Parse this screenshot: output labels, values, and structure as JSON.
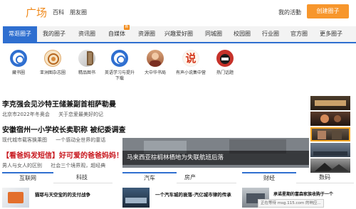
{
  "header": {
    "logo": "广场",
    "links": [
      "百科",
      "朋友圈"
    ],
    "activity": "我的活動",
    "create_button": "创建圈子"
  },
  "nav": {
    "tabs": [
      "常逛圈子",
      "我的圈子",
      "资讯圈",
      "自媒体",
      "资源圈",
      "兴趣爱好圈",
      "同城圈",
      "校园圈",
      "行业圈",
      "官方圈",
      "更多圈子"
    ],
    "active": "常逛圈子",
    "badge": "新"
  },
  "icon_row": {
    "items": [
      "藏书圈",
      "亚洲图杂志圈",
      "精品图书",
      "英语学习与提升下载",
      "大中华书局",
      "有声小说集中营",
      "热门话题"
    ],
    "item_3": "英语学习与提升下载",
    "item_6_glyph": "说",
    "item_4_glyph": "🎓"
  },
  "articles": [
    {
      "title": "李克强会见沙特王储兼副首相萨勒曼",
      "subs": [
        "北京市2022年冬奥会",
        "关于恋爱最美好的记"
      ]
    },
    {
      "title": "安徽宿州一小学校长卖职称 被纪委调查",
      "subs": [
        "现代城市载客换乘图",
        "一个感动全世界的童话"
      ]
    },
    {
      "title": "【看爸妈发短信】好可爱的爸爸妈妈！",
      "subs": [
        "男人与女人的区别",
        "社会三个境界观，超经典"
      ]
    }
  ],
  "feature": {
    "caption": "马来西亚棕榈林栖地为失联航班后落"
  },
  "sections": [
    {
      "tabs": [
        "互联网",
        "科技"
      ],
      "item": "猫耶与天空宝的的支付战争"
    },
    {
      "tabs": [
        "汽车",
        "房产"
      ],
      "item": "一个汽车城的衰落-汽亿城市律的传承"
    },
    {
      "tabs": [
        "财经",
        "数码"
      ],
      "item": "承诺星期的富森家族收购于一个"
    }
  ],
  "status_bar": "正在等待 msg.115.com 的响应..."
}
